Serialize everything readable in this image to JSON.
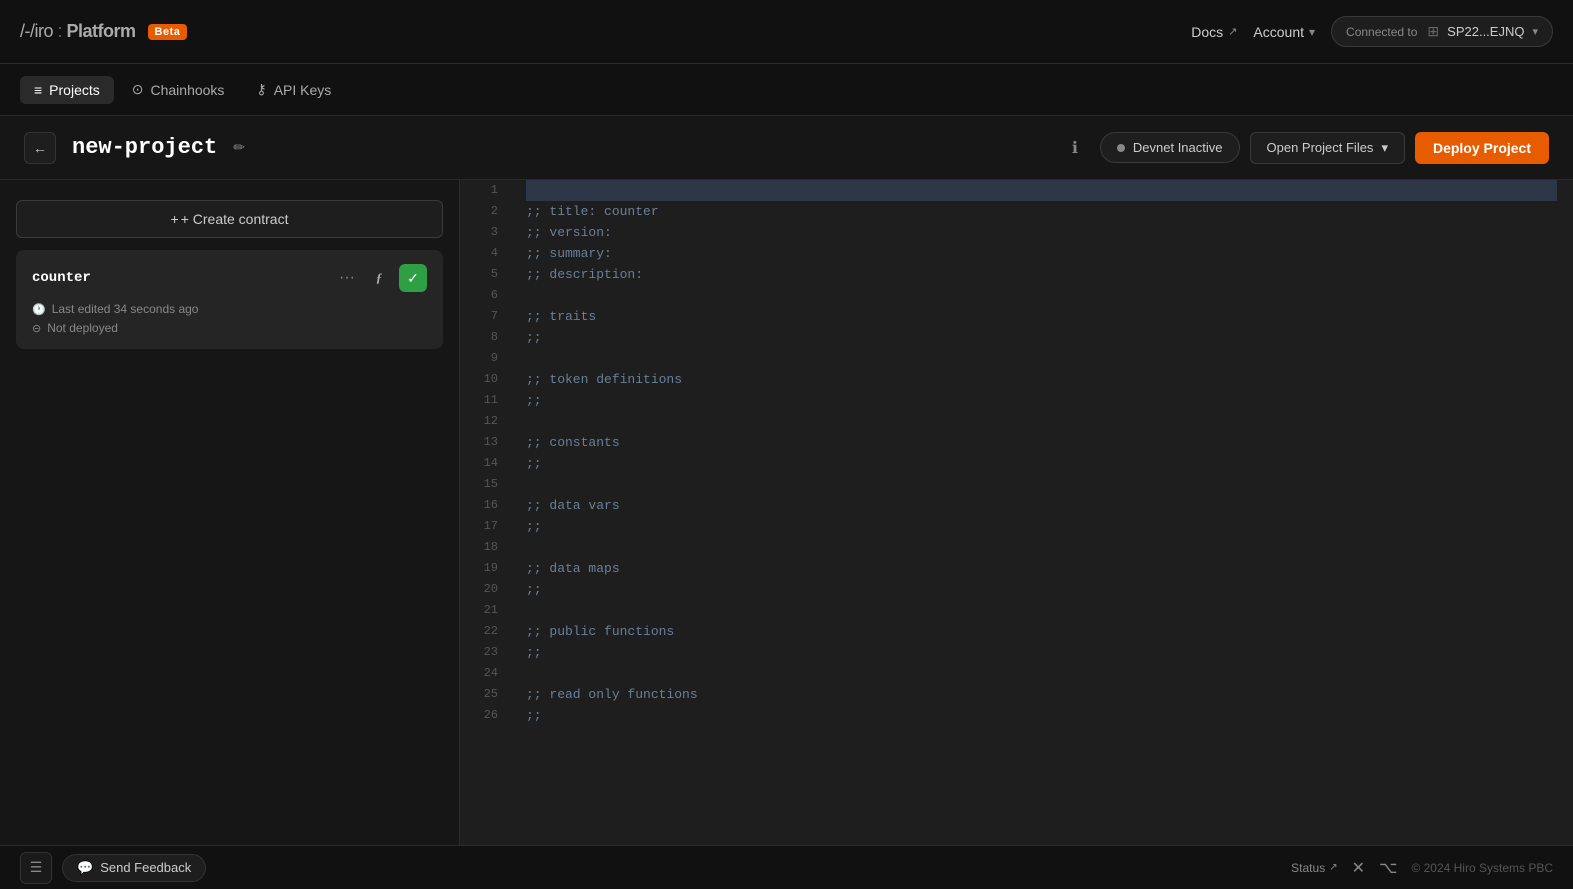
{
  "app": {
    "logo": "/-/iro",
    "logo_separator": " : ",
    "logo_platform": "Platform",
    "beta_label": "Beta"
  },
  "top_nav": {
    "docs_label": "Docs",
    "account_label": "Account",
    "connected_label": "Connected to",
    "wallet_icon": "⊞",
    "wallet_address": "SP22...EJNQ"
  },
  "secondary_nav": {
    "tabs": [
      {
        "id": "projects",
        "label": "Projects",
        "icon": "≡",
        "active": true
      },
      {
        "id": "chainhooks",
        "label": "Chainhooks",
        "icon": "⊙"
      },
      {
        "id": "api-keys",
        "label": "API Keys",
        "icon": "⚷"
      }
    ]
  },
  "project": {
    "name": "new-project",
    "back_tooltip": "Back",
    "devnet_label": "Devnet Inactive",
    "open_files_label": "Open Project Files",
    "deploy_label": "Deploy Project"
  },
  "sidebar": {
    "create_label": "+ Create contract",
    "contract": {
      "name": "counter",
      "last_edited": "Last edited 34 seconds ago",
      "status": "Not deployed"
    }
  },
  "editor": {
    "lines": [
      {
        "num": 1,
        "content": "",
        "highlighted": true
      },
      {
        "num": 2,
        "content": ";; title: counter"
      },
      {
        "num": 3,
        "content": ";; version:"
      },
      {
        "num": 4,
        "content": ";; summary:"
      },
      {
        "num": 5,
        "content": ";; description:"
      },
      {
        "num": 6,
        "content": ""
      },
      {
        "num": 7,
        "content": ";; traits"
      },
      {
        "num": 8,
        "content": ";;"
      },
      {
        "num": 9,
        "content": ""
      },
      {
        "num": 10,
        "content": ";; token definitions"
      },
      {
        "num": 11,
        "content": ";;"
      },
      {
        "num": 12,
        "content": ""
      },
      {
        "num": 13,
        "content": ";; constants"
      },
      {
        "num": 14,
        "content": ";;"
      },
      {
        "num": 15,
        "content": ""
      },
      {
        "num": 16,
        "content": ";; data vars"
      },
      {
        "num": 17,
        "content": ";;"
      },
      {
        "num": 18,
        "content": ""
      },
      {
        "num": 19,
        "content": ";; data maps"
      },
      {
        "num": 20,
        "content": ";;"
      },
      {
        "num": 21,
        "content": ""
      },
      {
        "num": 22,
        "content": ";; public functions"
      },
      {
        "num": 23,
        "content": ";;"
      },
      {
        "num": 24,
        "content": ""
      },
      {
        "num": 25,
        "content": ";; read only functions"
      },
      {
        "num": 26,
        "content": ";;"
      }
    ]
  },
  "footer": {
    "feedback_label": "Send Feedback",
    "status_label": "Status",
    "copyright": "© 2024 Hiro Systems PBC"
  },
  "colors": {
    "accent": "#e85c00",
    "active_green": "#2ea043",
    "bg_primary": "#111111",
    "bg_secondary": "#161616",
    "bg_card": "#252525",
    "border": "#2a2a2a"
  }
}
